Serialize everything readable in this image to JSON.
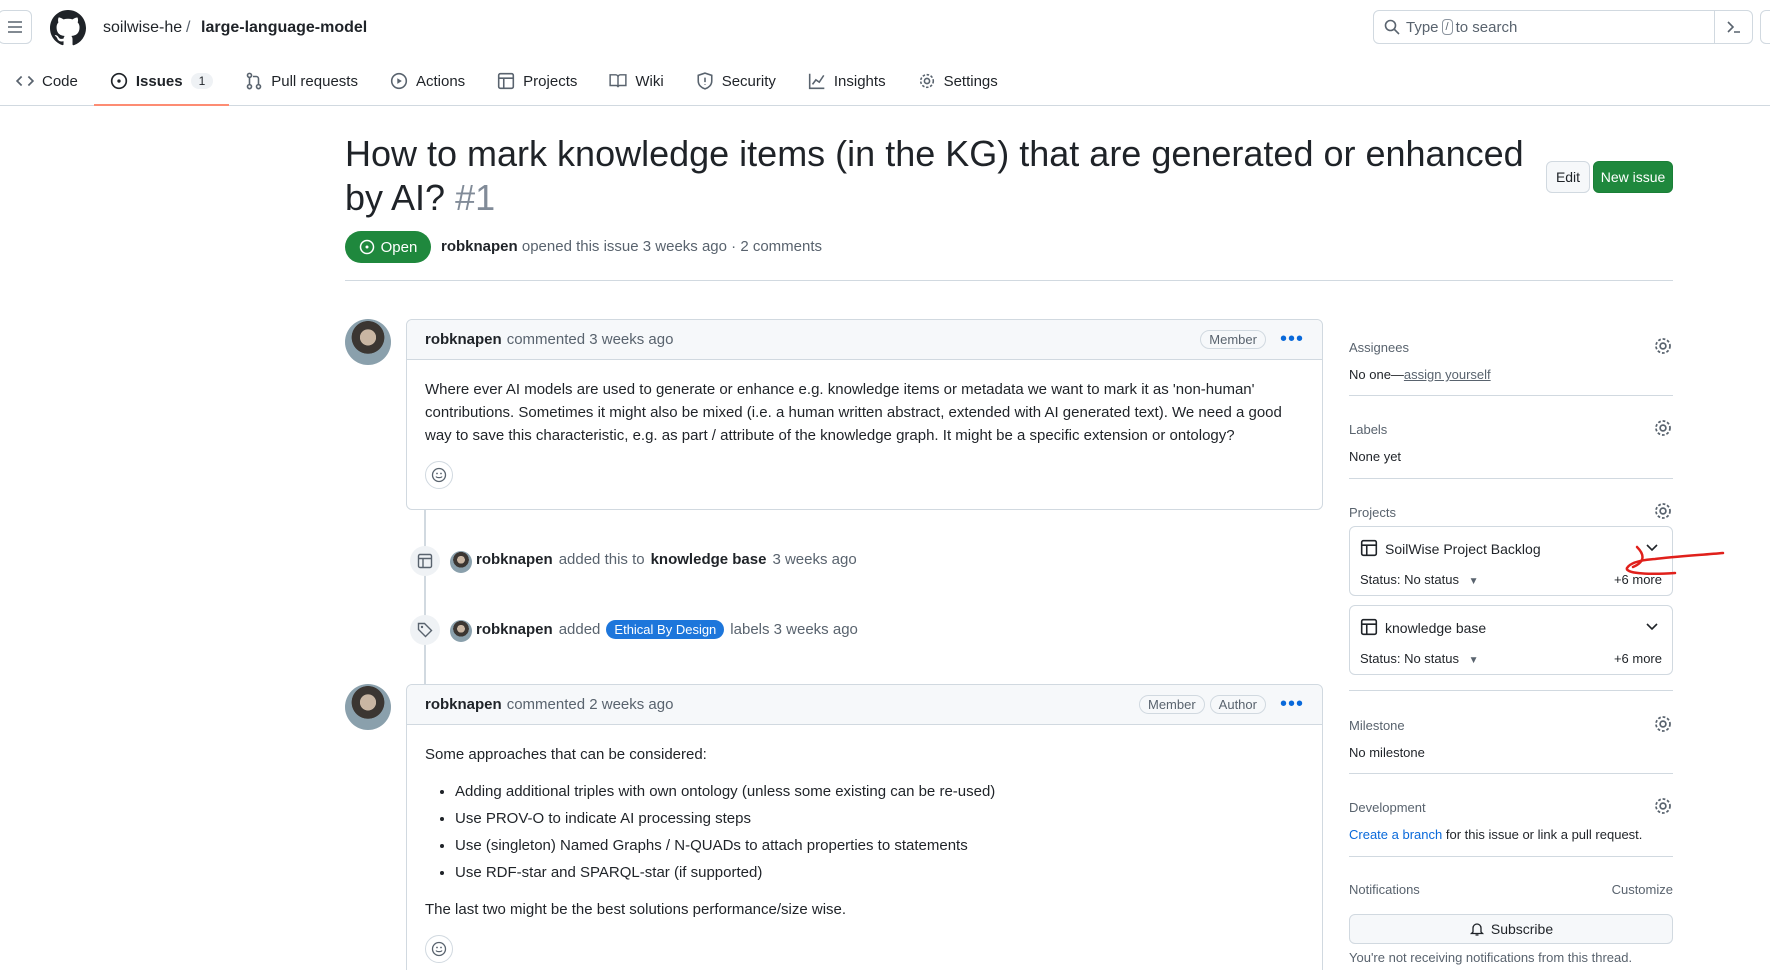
{
  "header": {
    "owner": "soilwise-he",
    "separator": "/",
    "repo": "large-language-model",
    "search_prefix": "Type",
    "search_key": "/",
    "search_suffix": "to search"
  },
  "tabs": [
    {
      "label": "Code"
    },
    {
      "label": "Issues",
      "count": "1"
    },
    {
      "label": "Pull requests"
    },
    {
      "label": "Actions"
    },
    {
      "label": "Projects"
    },
    {
      "label": "Wiki"
    },
    {
      "label": "Security"
    },
    {
      "label": "Insights"
    },
    {
      "label": "Settings"
    }
  ],
  "issue": {
    "title": "How to mark knowledge items (in the KG) that are generated or enhanced by AI?",
    "number": "#1",
    "edit_label": "Edit",
    "new_issue_label": "New issue",
    "state": "Open",
    "author": "robknapen",
    "meta_rest": "opened this issue 3 weeks ago · 2 comments"
  },
  "comments": [
    {
      "author": "robknapen",
      "when": "commented 3 weeks ago",
      "roles": [
        "Member"
      ],
      "body": "Where ever AI models are used to generate or enhance e.g. knowledge items or metadata we want to mark it as 'non-human' contributions. Sometimes it might also be mixed (i.e. a human written abstract, extended with AI generated text). We need a good way to save this characteristic, e.g. as part / attribute of the knowledge graph. It might be a specific extension or ontology?"
    },
    {
      "author": "robknapen",
      "when": "commented 2 weeks ago",
      "roles": [
        "Member",
        "Author"
      ],
      "intro": "Some approaches that can be considered:",
      "items": [
        "Adding additional triples with own ontology (unless some existing can be re-used)",
        "Use PROV-O to indicate AI processing steps",
        "Use (singleton) Named Graphs / N-QUADs to attach properties to statements",
        "Use RDF-star and SPARQL-star (if supported)"
      ],
      "outro": "The last two might be the best solutions performance/size wise."
    }
  ],
  "events": [
    {
      "author": "robknapen",
      "action": "added this to",
      "target": "knowledge base",
      "when": "3 weeks ago"
    },
    {
      "author": "robknapen",
      "action": "added",
      "label": "Ethical By Design",
      "suffix": "labels 3 weeks ago"
    }
  ],
  "sidebar": {
    "assignees": {
      "title": "Assignees",
      "value_prefix": "No one—",
      "value_link": "assign yourself"
    },
    "labels": {
      "title": "Labels",
      "value": "None yet"
    },
    "projects": {
      "title": "Projects",
      "cards": [
        {
          "name": "SoilWise Project Backlog",
          "status": "Status: No status",
          "more": "+6 more"
        },
        {
          "name": "knowledge base",
          "status": "Status: No status",
          "more": "+6 more"
        }
      ]
    },
    "milestone": {
      "title": "Milestone",
      "value": "No milestone"
    },
    "development": {
      "title": "Development",
      "link": "Create a branch",
      "rest": "for this issue or link a pull request."
    },
    "notifications": {
      "title": "Notifications",
      "customize": "Customize",
      "subscribe": "Subscribe",
      "note": "You're not receiving notifications from this thread."
    }
  },
  "colors": {
    "open_green": "#1f883d",
    "label_blue": "#1d76db",
    "tab_underline": "#fd8c73",
    "annotation_red": "#e0201b"
  }
}
